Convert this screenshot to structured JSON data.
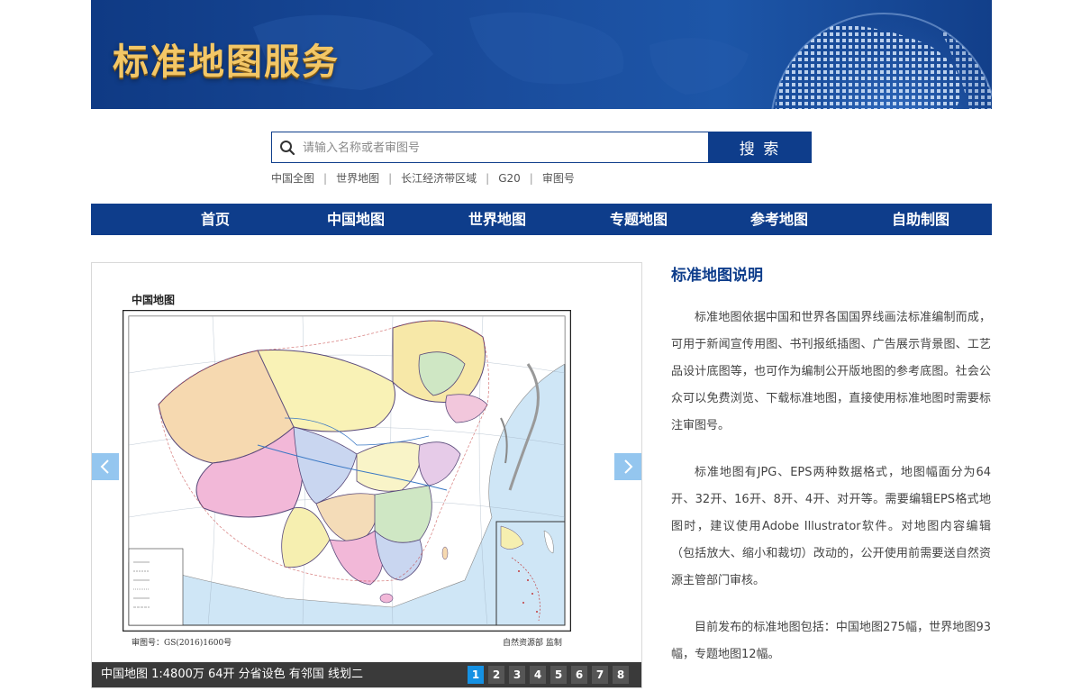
{
  "banner": {
    "title": "标准地图服务"
  },
  "search": {
    "placeholder": "请输入名称或者审图号",
    "button_label": "搜 索"
  },
  "quick_links": [
    "中国全图",
    "世界地图",
    "长江经济带区域",
    "G20",
    "审图号"
  ],
  "nav": [
    "首页",
    "中国地图",
    "世界地图",
    "专题地图",
    "参考地图",
    "自助制图"
  ],
  "slider": {
    "map_heading": "中国地图",
    "map_approval": "审图号：GS(2016)1600号",
    "map_publisher": "自然资源部  监制",
    "caption": "中国地图 1:4800万 64开 分省设色 有邻国 线划二",
    "pages": [
      "1",
      "2",
      "3",
      "4",
      "5",
      "6",
      "7",
      "8"
    ],
    "active_page": "1"
  },
  "description": {
    "title": "标准地图说明",
    "paragraphs": [
      "标准地图依据中国和世界各国国界线画法标准编制而成，可用于新闻宣传用图、书刊报纸插图、广告展示背景图、工艺品设计底图等，也可作为编制公开版地图的参考底图。社会公众可以免费浏览、下载标准地图，直接使用标准地图时需要标注审图号。",
      "标准地图有JPG、EPS两种数据格式，地图幅面分为64开、32开、16开、8开、4开、对开等。需要编辑EPS格式地图时，建议使用Adobe Illustrator软件。对地图内容编辑（包括放大、缩小和裁切）改动的，公开使用前需要送自然资源主管部门审核。",
      "目前发布的标准地图包括：中国地图275幅，世界地图93幅，专题地图12幅。"
    ]
  },
  "colors": {
    "brand_blue": "#0e3d8b",
    "title_gold": "#f3c766",
    "pager_active": "#1591e3",
    "caption_bg": "#3a3a3a"
  }
}
